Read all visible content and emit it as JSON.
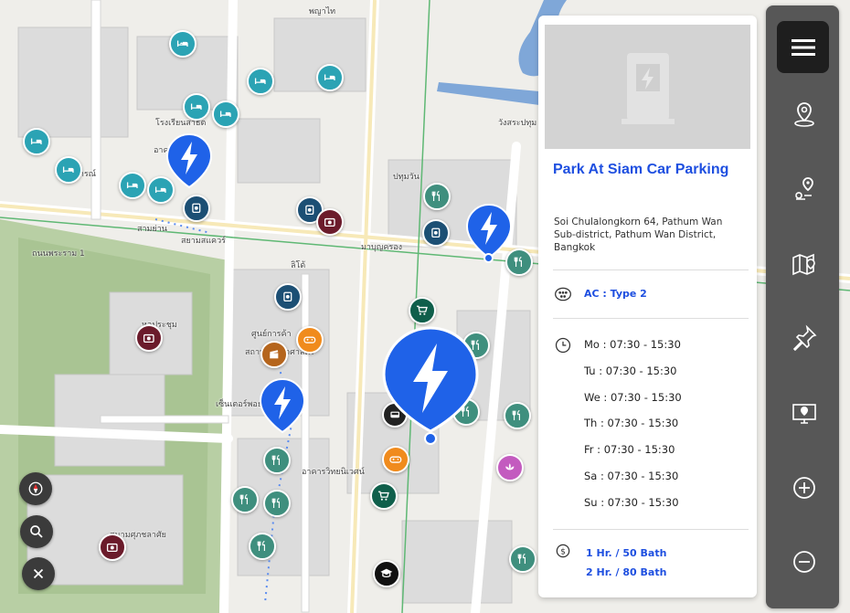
{
  "map": {
    "labels": [
      "โรงเรียนสาธิต",
      "จุฬาลงกรณ์",
      "สามย่าน",
      "สยามสแควร์",
      "ลิโด้",
      "มาบุญครอง",
      "ปทุมวัน",
      "อาคารจอดรถ",
      "สถาบันวิทยาศาสตร์",
      "วังสระปทุม",
      "ศูนย์การค้า",
      "สนามศุภชลาศัย",
      "เซ็นเตอร์พอยต์",
      "อาคารวิทยนิเวศน์",
      "หอประชุม",
      "ถนนพระราม 1",
      "พญาไท"
    ]
  },
  "panel": {
    "title": "Park At Siam Car Parking",
    "address": "Soi Chulalongkorn 64, Pathum Wan Sub-district, Pathum Wan District, Bangkok",
    "plug": "AC : Type 2",
    "hours": [
      "Mo : 07:30 - 15:30",
      "Tu : 07:30 - 15:30",
      "We : 07:30 - 15:30",
      "Th : 07:30 - 15:30",
      "Fr : 07:30 - 15:30",
      "Sa : 07:30 - 15:30",
      "Su : 07:30 - 15:30"
    ],
    "prices": [
      "1 Hr. / 50 Bath",
      "2 Hr. / 80 Bath"
    ]
  },
  "toolbar": {
    "tools": [
      "location-pin-icon",
      "route-icon",
      "map-icon",
      "pin-icon",
      "monitor-pin-icon",
      "zoom-in-icon",
      "zoom-out-icon"
    ]
  },
  "map_controls": [
    "compass-icon",
    "search-icon",
    "close-icon"
  ],
  "colors": {
    "accent": "#1e4fe0",
    "ev_pin": "#1f62e8",
    "hotel": "#2ba3b4",
    "restaurant": "#3f8f7e",
    "fuel": "#1c4f74",
    "shop": "#0f5f4b",
    "camera": "#6b1b2b",
    "entertainment": "#f08b1d",
    "cinema": "#b5651d",
    "spa": "#c35bbf",
    "school": "#111111"
  }
}
